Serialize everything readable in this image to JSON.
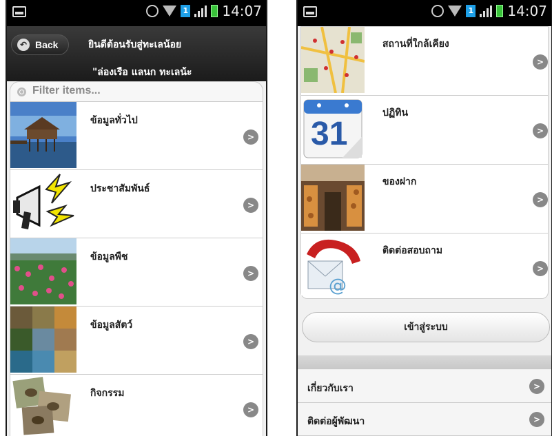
{
  "status_bar": {
    "time": "14:07",
    "sim_badge": "1"
  },
  "left_screen": {
    "back_label": "Back",
    "title_line1": "ยินดีต้อนรับสู่ทะเลน้อย",
    "title_line2": "\"ล่องเรือ แลนก ทะเลน้ะ",
    "filter_placeholder": "Filter items...",
    "items": [
      {
        "label": "ข้อมูลทั่วไป",
        "icon": "stilt-house-photo"
      },
      {
        "label": "ประชาสัมพันธ์",
        "icon": "megaphone-icon"
      },
      {
        "label": "ข้อมูลพืช",
        "icon": "lotus-field-photo"
      },
      {
        "label": "ข้อมูลสัตว์",
        "icon": "animal-collage-photo"
      },
      {
        "label": "กิจกรรม",
        "icon": "bird-photos"
      }
    ]
  },
  "right_screen": {
    "items": [
      {
        "label": "สถานที่ใกล้เคียง",
        "icon": "map-icon"
      },
      {
        "label": "ปฏิทิน",
        "icon": "calendar-icon",
        "calendar_day": "31"
      },
      {
        "label": "ของฝาก",
        "icon": "market-photo"
      },
      {
        "label": "ติดต่อสอบถาม",
        "icon": "phone-email-icon"
      }
    ],
    "login_button": "เข้าสู่ระบบ",
    "footer_links": [
      {
        "label": "เกี่ยวกับเรา"
      },
      {
        "label": "ติดต่อผู้พัฒนา"
      }
    ]
  },
  "colors": {
    "header_bg": "#2a2a2a",
    "chevron": "#888888",
    "battery": "#39c23a",
    "sim": "#1ea0e8"
  }
}
